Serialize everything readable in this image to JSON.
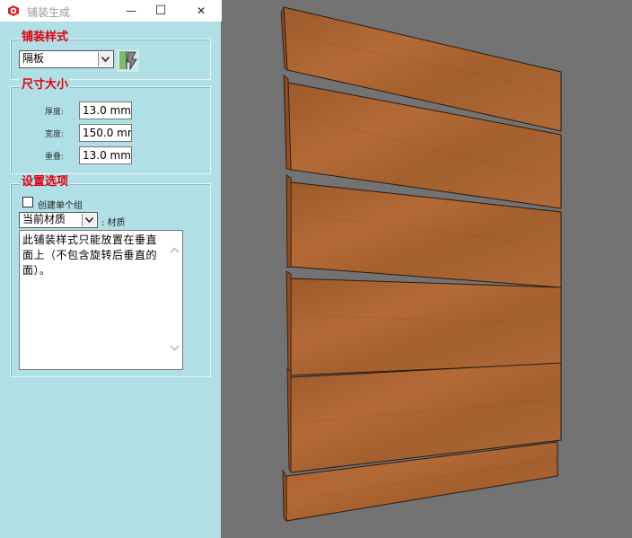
{
  "window": {
    "title": "铺装生成",
    "minimize_glyph": "—",
    "maximize_glyph": "☐",
    "close_glyph": "✕",
    "app_icon": "sketchup-icon"
  },
  "paving_style": {
    "group_label": "铺装样式",
    "selected": "隔板"
  },
  "dimensions": {
    "group_label": "尺寸大小",
    "fields": [
      {
        "label": "厚度:",
        "value": "13.0 mm"
      },
      {
        "label": "宽度:",
        "value": "150.0 mm"
      },
      {
        "label": "重叠:",
        "value": "13.0 mm"
      }
    ]
  },
  "options": {
    "group_label": "设置选项",
    "create_single_group_label": "创建单个组",
    "create_single_group_checked": false,
    "material_selected": "当前材质",
    "material_suffix": ": 材质",
    "note": "此铺装样式只能放置在垂直面上（不包含旋转后垂直的面）。"
  },
  "colors": {
    "panel_bg": "#b0e0e6",
    "group_label": "#e0000f",
    "viewport_bg": "#737373",
    "wood": "#a65b2a"
  }
}
